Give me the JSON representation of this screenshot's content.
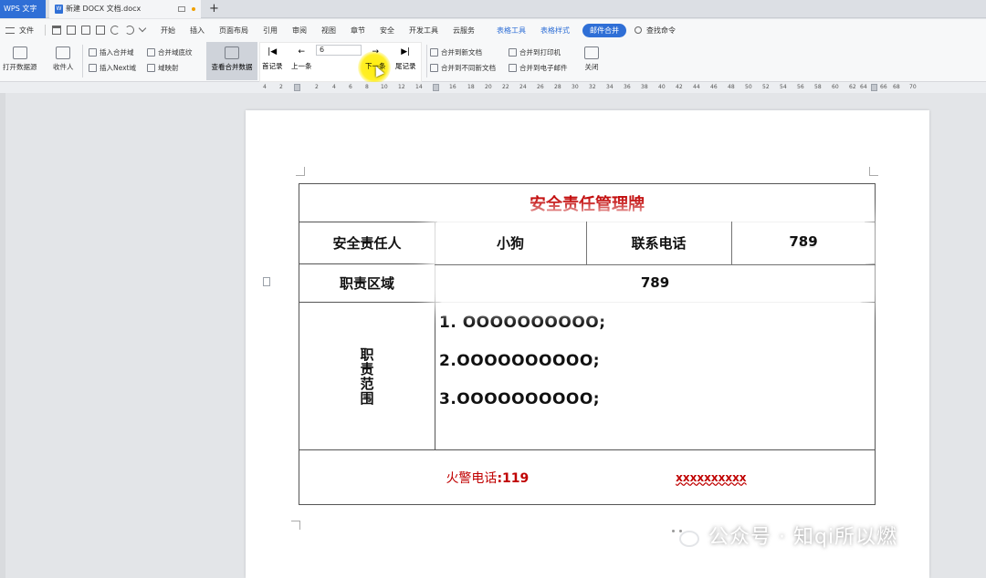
{
  "tabs": {
    "app_tab": "WPS 文字",
    "doc_tab": "新建 DOCX 文档.docx",
    "doc_icon": "W",
    "add_tab": "+"
  },
  "menu": {
    "file": "文件",
    "items": [
      "开始",
      "插入",
      "页面布局",
      "引用",
      "审阅",
      "视图",
      "章节",
      "安全",
      "开发工具",
      "云服务"
    ],
    "context_items": [
      "表格工具",
      "表格样式"
    ],
    "active_item": "邮件合并",
    "search": "查找命令"
  },
  "ribbon": {
    "open_source": "打开数据源",
    "recipients": "收件人",
    "insert_merge_field": "插入合并域",
    "insert_next_field": "插入Next域",
    "merge_field_shading": "合并域底纹",
    "field_mapping": "域映射",
    "view_merged_data": "查看合并数据",
    "first_record": "首记录",
    "prev_record": "上一条",
    "record_number": "6",
    "next_record": "下一条",
    "last_record": "尾记录",
    "merge_to_new_doc": "合并到新文档",
    "merge_to_separate_docs": "合并到不同新文档",
    "merge_to_printer": "合并到打印机",
    "merge_to_email": "合并到电子邮件",
    "close": "关闭"
  },
  "ruler": {
    "ticks": [
      "4",
      "2",
      "2",
      "4",
      "6",
      "8",
      "10",
      "12",
      "14",
      "16",
      "18",
      "20",
      "22",
      "24",
      "26",
      "28",
      "30",
      "32",
      "34",
      "36",
      "38",
      "40",
      "42",
      "44",
      "46",
      "48",
      "50",
      "52",
      "54",
      "56",
      "58",
      "60",
      "62",
      "64",
      "66",
      "68",
      "70",
      "72"
    ]
  },
  "table": {
    "title": "安全责任管理牌",
    "responsible_label": "安全责任人",
    "responsible_value": "小狗",
    "phone_label": "联系电话",
    "phone_value": "789",
    "area_label": "职责区域",
    "area_value": "789",
    "scope_label": "职责范围",
    "scope_items": [
      "1. OOOOOOOOOO;",
      "2.OOOOOOOOOO;",
      "3.OOOOOOOOOO;"
    ],
    "fire_label": "火警电话",
    "fire_number": ":119",
    "footer_placeholder": "xxxxxxxxxx"
  },
  "watermark": {
    "text": "公众号 · 知qi所以燃"
  },
  "colors": {
    "accent_blue": "#2f6fd6",
    "title_red": "#c00000",
    "cursor_highlight": "#ffec00"
  }
}
